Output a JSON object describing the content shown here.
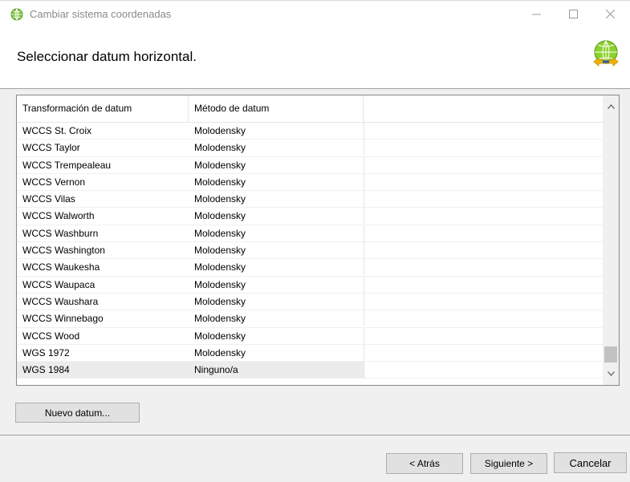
{
  "window": {
    "title": "Cambiar sistema coordenadas"
  },
  "header": {
    "title": "Seleccionar datum horizontal."
  },
  "grid": {
    "columns": [
      "Transformación de datum",
      "Método de datum",
      ""
    ],
    "rows": [
      {
        "transform": "WCCS St. Croix",
        "method": "Molodensky"
      },
      {
        "transform": "WCCS Taylor",
        "method": "Molodensky"
      },
      {
        "transform": "WCCS Trempealeau",
        "method": "Molodensky"
      },
      {
        "transform": "WCCS Vernon",
        "method": "Molodensky"
      },
      {
        "transform": "WCCS Vilas",
        "method": "Molodensky"
      },
      {
        "transform": "WCCS Walworth",
        "method": "Molodensky"
      },
      {
        "transform": "WCCS Washburn",
        "method": "Molodensky"
      },
      {
        "transform": "WCCS Washington",
        "method": "Molodensky"
      },
      {
        "transform": "WCCS Waukesha",
        "method": "Molodensky"
      },
      {
        "transform": "WCCS Waupaca",
        "method": "Molodensky"
      },
      {
        "transform": "WCCS Waushara",
        "method": "Molodensky"
      },
      {
        "transform": "WCCS Winnebago",
        "method": "Molodensky"
      },
      {
        "transform": "WCCS Wood",
        "method": "Molodensky"
      },
      {
        "transform": "WGS 1972",
        "method": "Molodensky"
      },
      {
        "transform": "WGS 1984",
        "method": "Ninguno/a",
        "selected": true
      }
    ]
  },
  "buttons": {
    "new_datum": "Nuevo datum...",
    "back": "< Atrás",
    "next": "Siguiente >",
    "cancel": "Cancelar"
  },
  "icons": {
    "app": "globe-icon",
    "header": "globe-arrows-icon"
  }
}
